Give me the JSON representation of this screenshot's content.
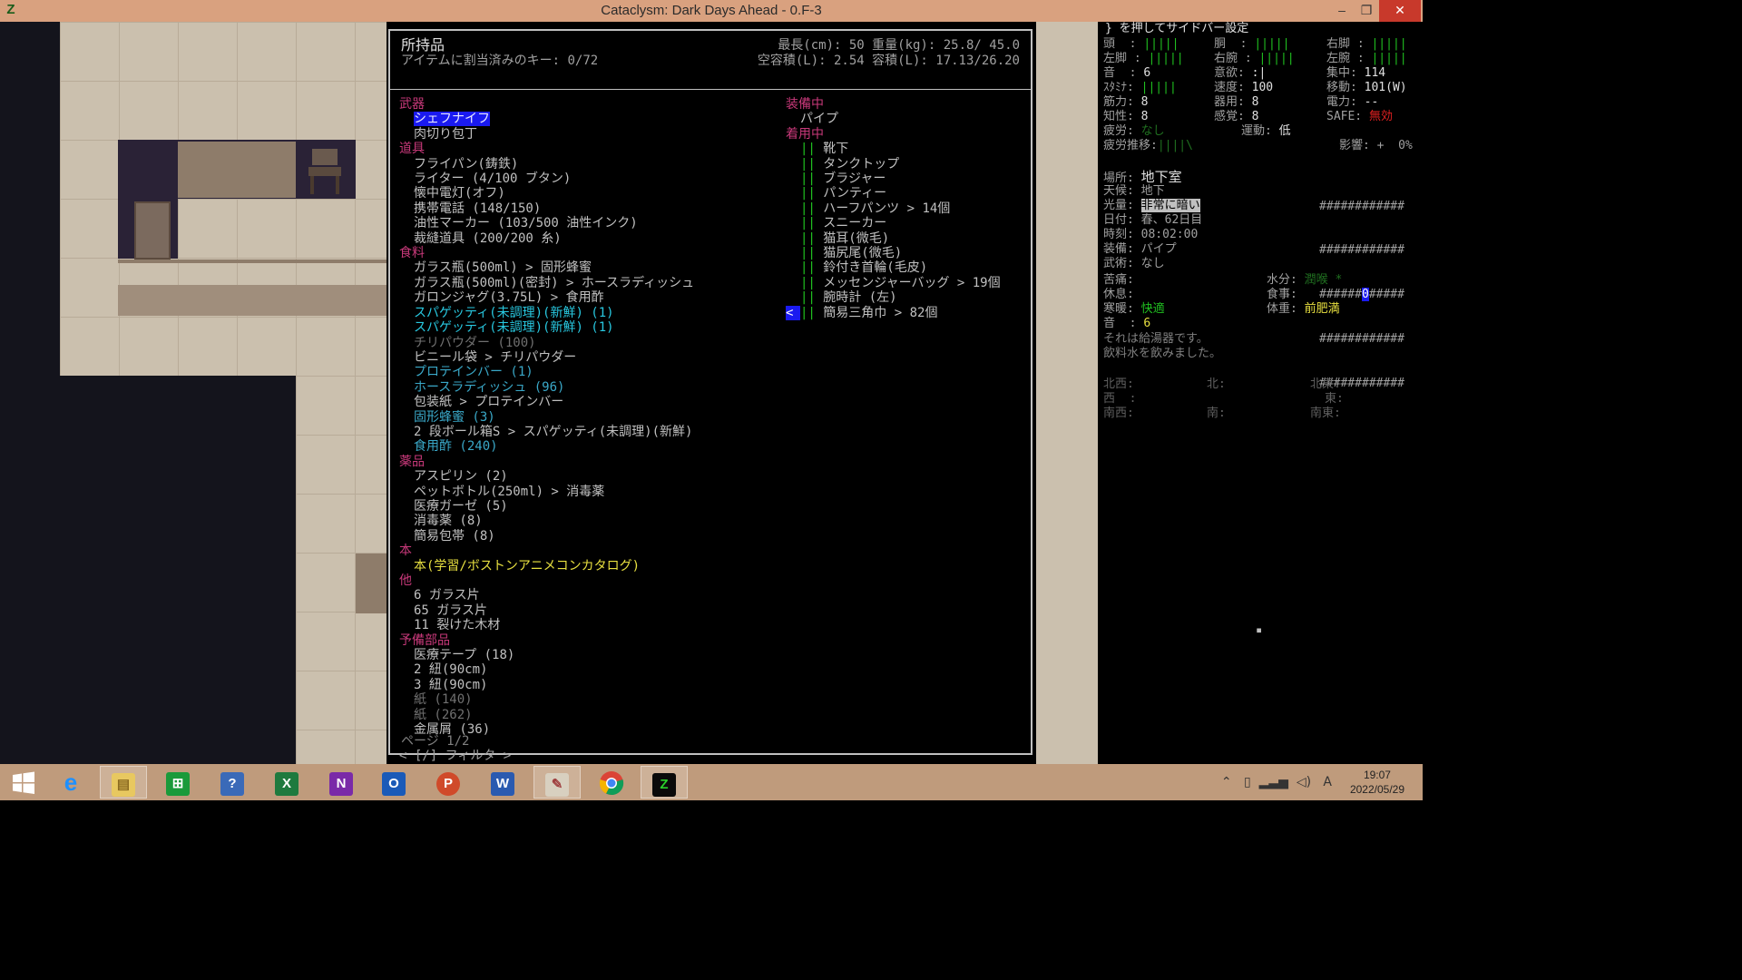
{
  "window": {
    "title": "Cataclysm: Dark Days Ahead - 0.F-3",
    "minimize": "–",
    "maximize": "❐",
    "close": "✕"
  },
  "inventory": {
    "title": "所持品",
    "assigned_keys": "アイテムに割当済みのキー: 0/72",
    "stats_line1": "最長(cm): 50 重量(kg):  25.8/ 45.0",
    "stats_line2": "空容積(L): 2.54 容積(L): 17.13/26.20",
    "left_column": [
      {
        "type": "cat",
        "text": "武器"
      },
      {
        "type": "item",
        "text": "シェフナイフ",
        "style": "sel"
      },
      {
        "type": "item",
        "text": "肉切り包丁",
        "style": "gray"
      },
      {
        "type": "cat",
        "text": "道具"
      },
      {
        "type": "item",
        "text": "フライパン(鋳鉄)",
        "style": "gray"
      },
      {
        "type": "item",
        "text": "ライター (4/100 ブタン)",
        "style": "gray"
      },
      {
        "type": "item",
        "text": "懐中電灯(オフ)",
        "style": "gray"
      },
      {
        "type": "item",
        "text": "携帯電話 (148/150)",
        "style": "gray"
      },
      {
        "type": "item",
        "text": "油性マーカー (103/500 油性インク)",
        "style": "gray"
      },
      {
        "type": "item",
        "text": "裁縫道具 (200/200 糸)",
        "style": "gray"
      },
      {
        "type": "cat",
        "text": "食料"
      },
      {
        "type": "item",
        "text": "ガラス瓶(500ml) > 固形蜂蜜",
        "style": "gray"
      },
      {
        "type": "item",
        "text": "ガラス瓶(500ml)(密封) > ホースラディッシュ",
        "style": "gray"
      },
      {
        "type": "item",
        "text": "ガロンジャグ(3.75L) > 食用酢",
        "style": "gray"
      },
      {
        "type": "item",
        "text": "スパゲッティ(未調理)(新鮮) (1)",
        "style": "cyan"
      },
      {
        "type": "item",
        "text": "スパゲッティ(未調理)(新鮮) (1)",
        "style": "cyan"
      },
      {
        "type": "item",
        "text": "チリパウダー (100)",
        "style": "dim"
      },
      {
        "type": "item",
        "text": "ビニール袋 > チリパウダー",
        "style": "gray"
      },
      {
        "type": "item",
        "text": "プロテインバー (1)",
        "style": "dcyan"
      },
      {
        "type": "item",
        "text": "ホースラディッシュ (96)",
        "style": "dcyan"
      },
      {
        "type": "item",
        "text": "包装紙 > プロテインバー",
        "style": "gray"
      },
      {
        "type": "item",
        "text": "固形蜂蜜 (3)",
        "style": "dcyan"
      },
      {
        "type": "item",
        "text": "2 段ボール箱S > スパゲッティ(未調理)(新鮮)",
        "style": "gray"
      },
      {
        "type": "item",
        "text": "食用酢 (240)",
        "style": "dcyan"
      },
      {
        "type": "cat",
        "text": "薬品"
      },
      {
        "type": "item",
        "text": "アスピリン (2)",
        "style": "gray"
      },
      {
        "type": "item",
        "text": "ペットボトル(250ml) > 消毒薬",
        "style": "gray"
      },
      {
        "type": "item",
        "text": "医療ガーゼ (5)",
        "style": "gray"
      },
      {
        "type": "item",
        "text": "消毒薬 (8)",
        "style": "gray"
      },
      {
        "type": "item",
        "text": "簡易包帯 (8)",
        "style": "gray"
      },
      {
        "type": "cat",
        "text": "本"
      },
      {
        "type": "item",
        "text": "本(学習/ボストンアニメコンカタログ)",
        "style": "yellow"
      },
      {
        "type": "cat",
        "text": "他"
      },
      {
        "type": "item",
        "text": "6 ガラス片",
        "style": "gray"
      },
      {
        "type": "item",
        "text": "65 ガラス片",
        "style": "gray"
      },
      {
        "type": "item",
        "text": "11 裂けた木材",
        "style": "gray"
      },
      {
        "type": "cat",
        "text": "予備部品"
      },
      {
        "type": "item",
        "text": "医療テープ (18)",
        "style": "gray"
      },
      {
        "type": "item",
        "text": "2 紐(90cm)",
        "style": "gray"
      },
      {
        "type": "item",
        "text": "3 紐(90cm)",
        "style": "gray"
      },
      {
        "type": "item",
        "text": "紙 (140)",
        "style": "dim"
      },
      {
        "type": "item",
        "text": "紙 (262)",
        "style": "dim"
      },
      {
        "type": "item",
        "text": "金属屑 (36)",
        "style": "gray"
      }
    ],
    "wielded_header": "装備中",
    "wielded_item": "パイプ",
    "worn_header": "着用中",
    "worn_items": [
      "靴下",
      "タンクトップ",
      "ブラジャー",
      "パンティー",
      "ハーフパンツ > 14個",
      "スニーカー",
      "猫耳(微毛)",
      "猫尻尾(微毛)",
      "鈴付き首輪(毛皮)",
      "メッセンジャーバッグ > 19個",
      "腕時計 (左)",
      "簡易三角巾 > 82個"
    ],
    "worn_mark": "||",
    "cursor_glyph": "<",
    "page_text": "ページ 1/2",
    "filter_text": "< [/] フィルタ >"
  },
  "sidebar": {
    "header": "} を押してサイドバー設定",
    "body_rows": [
      [
        "頭  : |||||",
        "胴  : |||||",
        "右脚 : |||||"
      ],
      [
        "左脚 : |||||",
        "右腕 : |||||",
        "左腕 : |||||"
      ]
    ],
    "stats": {
      "sound_label": "音  :",
      "sound_val": "6",
      "will_label": "意欲:",
      "will_val": ":|",
      "focus_label": "集中:",
      "focus_val": "114",
      "stamina_label": "ｽﾀﾐﾅ:",
      "stamina_val": "|||||",
      "speed_label": "速度:",
      "speed_val": "100",
      "move_label": "移動:",
      "move_val": "101(W)",
      "str_label": "筋力:",
      "str_val": "8",
      "dex_label": "器用:",
      "dex_val": "8",
      "power_label": "電力:",
      "power_val": "--",
      "int_label": "知性:",
      "int_val": "8",
      "per_label": "感覚:",
      "per_val": "8",
      "safe_label": "SAFE:",
      "safe_val": "無効",
      "fatigue_label": "疲労:",
      "fatigue_val": "なし",
      "activity_label": "運動:",
      "activity_val": "低",
      "fatigue_trend_label": "疲労推移:",
      "fatigue_trend_val": "||||\\",
      "effect_label": "影響: +  0%"
    },
    "location_label": "場所:",
    "location_val": "地下室",
    "weather_label": "天候:",
    "weather_val": "地下",
    "light_label": "光量:",
    "light_val": "非常に暗い",
    "date_label": "日付:",
    "date_val": "春、62日目",
    "time_label": "時刻:",
    "time_val": "08:02:00",
    "weapon_label": "装備:",
    "weapon_val": "パイプ",
    "style_label": "武術:",
    "style_val": "なし",
    "minimap_rows": [
      "############",
      "############",
      "######0#####",
      "############",
      "############"
    ],
    "pain_label": "苦痛:",
    "thirst_label": "水分:",
    "thirst_val": "潤喉 *",
    "rest_label": "休息:",
    "hunger_label": "食事:",
    "temp_label": "寒暖:",
    "temp_val": "快適",
    "weight_label": "体重:",
    "weight_val": "前肥満",
    "sound2_label": "音  :",
    "sound2_val": "6",
    "log1": "それは給湯器です。",
    "log2": "飲料水を飲みました。",
    "compass": {
      "nw": "北西:",
      "n": "北:",
      "ne": "北東:",
      "w": "西  :",
      "e": "東:",
      "sw": "南西:",
      "s": "南:",
      "se": "南東:"
    }
  },
  "taskbar": {
    "clock_time": "19:07",
    "clock_date": "2022/05/29",
    "ime": "A"
  }
}
